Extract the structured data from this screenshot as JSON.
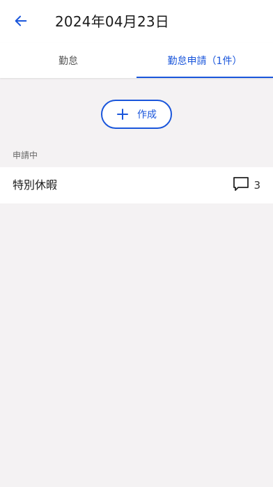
{
  "header": {
    "title": "2024年04月23日"
  },
  "tabs": [
    {
      "label": "勤怠",
      "selected": false
    },
    {
      "label": "勤怠申請（1件）",
      "selected": true
    }
  ],
  "create_button": {
    "label": "作成",
    "icon": "plus-icon"
  },
  "section": {
    "label": "申請中"
  },
  "requests": [
    {
      "title": "特別休暇",
      "comment_icon": "comment-icon",
      "comment_count": "3"
    }
  ],
  "colors": {
    "accent": "#1a56db",
    "background": "#f4f2f3",
    "surface": "#ffffff"
  }
}
